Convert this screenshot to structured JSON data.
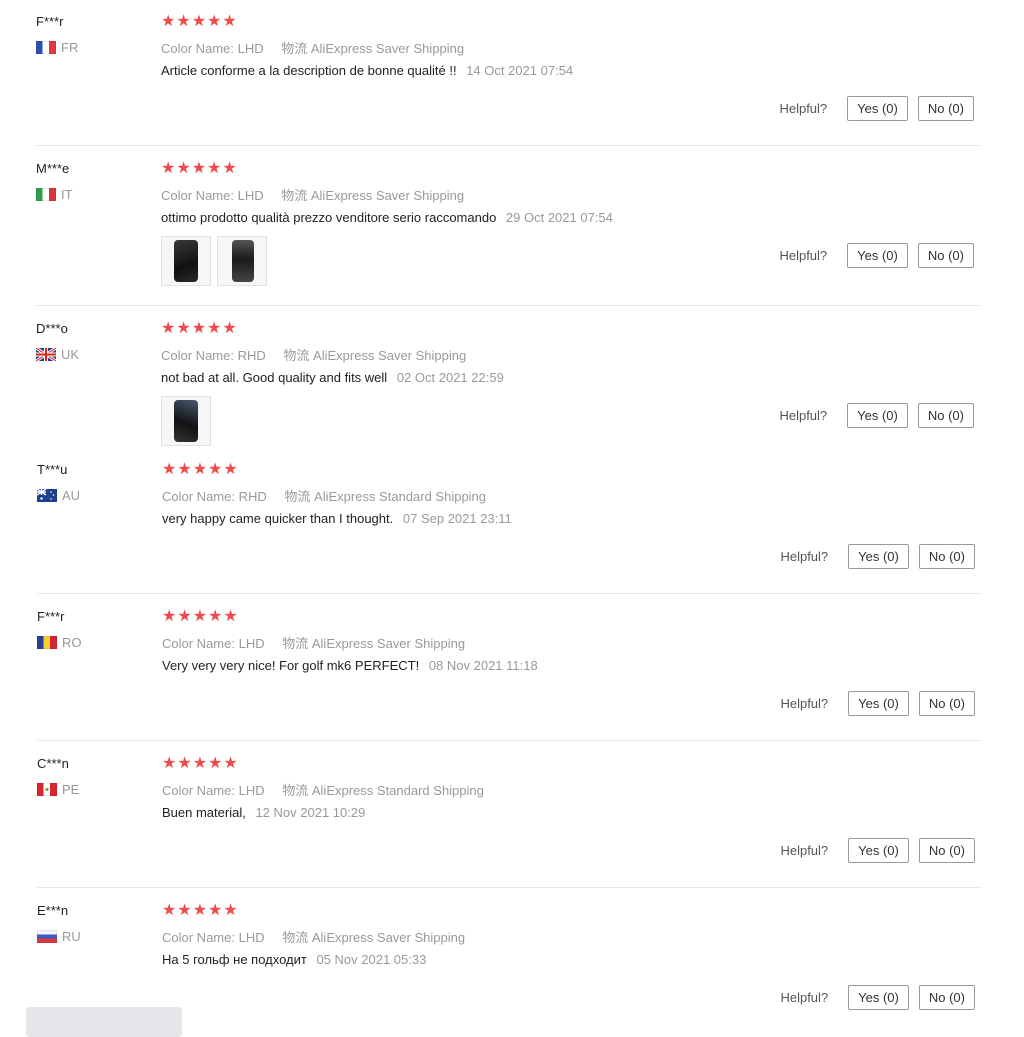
{
  "reviews": [
    {
      "user": "F***r",
      "country": "FR",
      "flag": "fr",
      "stars": "★★★★★",
      "color_key": "Color Name:",
      "color_val": "LHD",
      "ship_key": "物流",
      "ship_val": "AliExpress Saver Shipping",
      "text": "Article conforme a la description de bonne qualité !!",
      "date": "14 Oct 2021 07:54",
      "helpful": "Helpful?",
      "yes": "Yes (0)",
      "no": "No (0)"
    },
    {
      "user": "M***e",
      "country": "IT",
      "flag": "it",
      "stars": "★★★★★",
      "color_key": "Color Name:",
      "color_val": "LHD",
      "ship_key": "物流",
      "ship_val": "AliExpress Saver Shipping",
      "text": "ottimo prodotto qualità prezzo venditore serio raccomando",
      "date": "29 Oct 2021 07:54",
      "helpful": "Helpful?",
      "yes": "Yes (0)",
      "no": "No (0)"
    },
    {
      "user": "D***o",
      "country": "UK",
      "flag": "uk",
      "stars": "★★★★★",
      "color_key": "Color Name:",
      "color_val": "RHD",
      "ship_key": "物流",
      "ship_val": "AliExpress Saver Shipping",
      "text": "not bad at all. Good quality and fits well",
      "date": "02 Oct 2021 22:59",
      "helpful": "Helpful?",
      "yes": "Yes (0)",
      "no": "No (0)"
    },
    {
      "user": "T***u",
      "country": "AU",
      "flag": "au",
      "stars": "★★★★★",
      "color_key": "Color Name:",
      "color_val": "RHD",
      "ship_key": "物流",
      "ship_val": "AliExpress Standard Shipping",
      "text": "very happy came quicker than I thought.",
      "date": "07 Sep 2021 23:11",
      "helpful": "Helpful?",
      "yes": "Yes (0)",
      "no": "No (0)"
    },
    {
      "user": "F***r",
      "country": "RO",
      "flag": "ro",
      "stars": "★★★★★",
      "color_key": "Color Name:",
      "color_val": "LHD",
      "ship_key": "物流",
      "ship_val": "AliExpress Saver Shipping",
      "text": "Very very very nice! For golf mk6 PERFECT!",
      "date": "08 Nov 2021 11:18",
      "helpful": "Helpful?",
      "yes": "Yes (0)",
      "no": "No (0)"
    },
    {
      "user": "C***n",
      "country": "PE",
      "flag": "pe",
      "stars": "★★★★★",
      "color_key": "Color Name:",
      "color_val": "LHD",
      "ship_key": "物流",
      "ship_val": "AliExpress Standard Shipping",
      "text": "Buen material,",
      "date": "12 Nov 2021 10:29",
      "helpful": "Helpful?",
      "yes": "Yes (0)",
      "no": "No (0)"
    },
    {
      "user": "E***n",
      "country": "RU",
      "flag": "ru",
      "stars": "★★★★★",
      "color_key": "Color Name:",
      "color_val": "LHD",
      "ship_key": "物流",
      "ship_val": "AliExpress Saver Shipping",
      "text": "На 5 гольф не подходит",
      "date": "05 Nov 2021 05:33",
      "helpful": "Helpful?",
      "yes": "Yes (0)",
      "no": "No (0)"
    }
  ],
  "colors": {
    "star": "#ef4b4b",
    "muted": "#999999",
    "divider": "#e8e8e8"
  }
}
